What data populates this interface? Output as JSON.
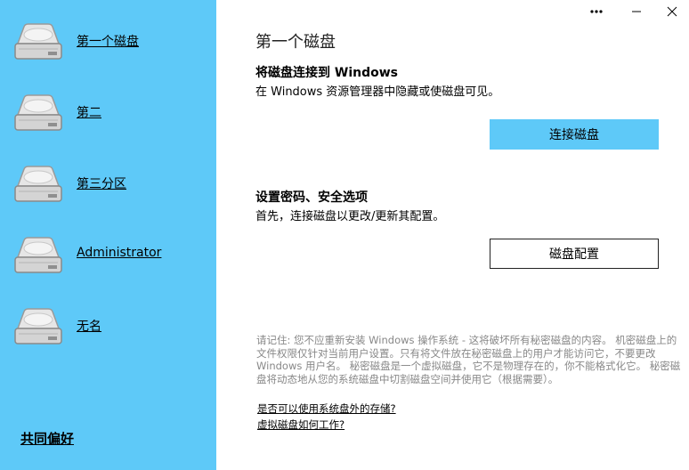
{
  "sidebar": {
    "disks": [
      {
        "label": "第一个磁盘",
        "icon": "hard-drive-icon"
      },
      {
        "label": "第二",
        "icon": "hard-drive-icon"
      },
      {
        "label": "第三分区",
        "icon": "hard-drive-icon"
      },
      {
        "label": "Administrator",
        "icon": "hard-drive-icon"
      },
      {
        "label": "无名",
        "icon": "hard-drive-icon"
      }
    ],
    "favorites_label": "共同偏好",
    "background_color": "#5ec9f8"
  },
  "window_controls": {
    "more": "•••",
    "minimize": "—",
    "close": "✕"
  },
  "main": {
    "title": "第一个磁盘",
    "connect_section": {
      "heading": "将磁盘连接到 Windows",
      "description": "在 Windows 资源管理器中隐藏或使磁盘可见。",
      "button_label": "连接磁盘"
    },
    "config_section": {
      "heading": "设置密码、安全选项",
      "description": "首先，连接磁盘以更改/更新其配置。",
      "button_label": "磁盘配置"
    },
    "notice_text": "请记住: 您不应重新安装 Windows 操作系统 - 这将破坏所有秘密磁盘的内容。 机密磁盘上的文件权限仅针对当前用户设置。只有将文件放在秘密磁盘上的用户才能访问它，不要更改 Windows 用户名。 秘密磁盘是一个虚拟磁盘，它不是物理存在的，你不能格式化它。 秘密磁盘将动态地从您的系统磁盘中切割磁盘空间并使用它（根据需要）。",
    "links": [
      "是否可以使用系统盘外的存储?",
      "虚拟磁盘如何工作?"
    ],
    "accent_color": "#5ec9f8"
  }
}
